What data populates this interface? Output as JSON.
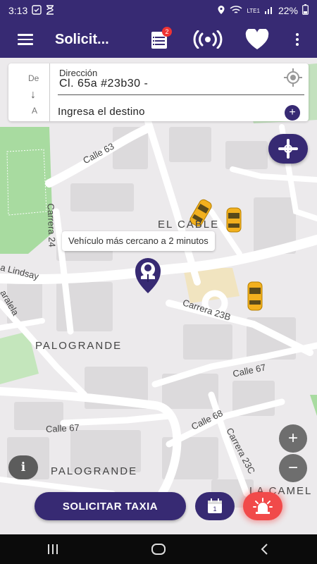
{
  "status_bar": {
    "time": "3:13",
    "battery": "22%",
    "network": "LTE1"
  },
  "app_bar": {
    "title": "Solicit...",
    "orders_badge": "2",
    "icons": [
      "menu-icon",
      "clipboard-list-icon",
      "broadcast-icon",
      "heart-icon",
      "more-vert-icon"
    ]
  },
  "address": {
    "from_label": "De",
    "to_label": "A",
    "direction_label": "Dirección",
    "direction_value": "Cl. 65a #23b30 -",
    "destination_placeholder": "Ingresa el destino"
  },
  "map": {
    "streets": {
      "calle63": "Calle 63",
      "carrera24": "Carrera 24",
      "lindsay": "a Lindsay",
      "paralela": "aralela",
      "carrera23b": "Carrera 23B",
      "calle67a": "Calle 67",
      "calle67b": "Calle 67",
      "calle68": "Calle 68",
      "carrera23c": "Carrera 23C"
    },
    "areas": {
      "elcable": "EL CABLE",
      "palogrande1": "PALOGRANDE",
      "palogrande2": "PALOGRANDE",
      "lacamel": "LA CAMEL"
    }
  },
  "tooltip": "Vehículo más cercano a 2 minutos",
  "buttons": {
    "request": "SOLICITAR TAXIA",
    "info": "i",
    "zoom_in": "+",
    "zoom_out": "−",
    "calendar_day": "1"
  },
  "colors": {
    "brand": "#372a73",
    "alarm": "#f14a4a",
    "taxi": "#f2b01e",
    "park": "#a8dba0"
  }
}
